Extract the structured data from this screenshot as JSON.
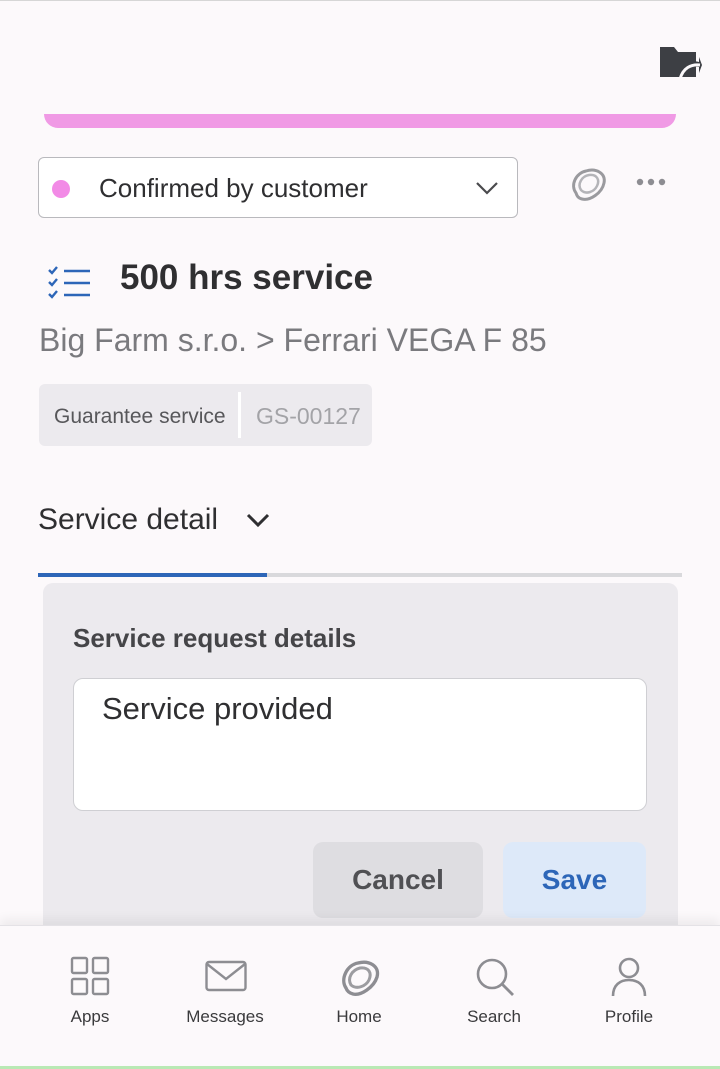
{
  "header": {
    "back_icon": "folder-back-icon",
    "accent_band_color": "#f09ae5"
  },
  "status": {
    "selected": "Confirmed by customer",
    "dot_color": "#f28ae6"
  },
  "actions": {
    "logo_icon": "app-logo-icon",
    "more_icon": "more-horizontal-icon"
  },
  "task": {
    "icon": "checklist-icon",
    "title": "500 hrs service",
    "breadcrumb": "Big Farm s.r.o. > Ferrari VEGA F 85",
    "tags": {
      "type": "Guarantee service",
      "id": "GS-00127"
    }
  },
  "section": {
    "label": "Service detail",
    "progress_fraction": 0.355,
    "accent_color": "#2d66b8"
  },
  "card": {
    "title": "Service request details",
    "value": "Service provided",
    "cancel_label": "Cancel",
    "save_label": "Save"
  },
  "bottom_nav": {
    "items": [
      {
        "label": "Apps",
        "icon": "apps-grid-icon"
      },
      {
        "label": "Messages",
        "icon": "mail-icon"
      },
      {
        "label": "Home",
        "icon": "home-logo-icon"
      },
      {
        "label": "Search",
        "icon": "search-icon"
      },
      {
        "label": "Profile",
        "icon": "profile-icon"
      }
    ]
  }
}
